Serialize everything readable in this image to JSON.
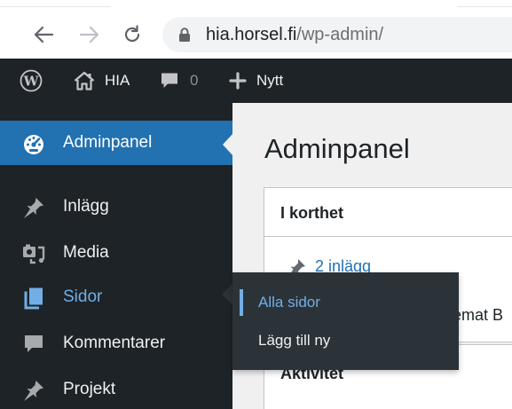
{
  "browser": {
    "url_host": "hia.horsel.fi",
    "url_path": "/wp-admin/"
  },
  "admin_bar": {
    "site_name": "HIA",
    "comments_count": "0",
    "new_label": "Nytt"
  },
  "sidebar": {
    "items": [
      {
        "label": "Adminpanel",
        "icon": "dashboard-icon",
        "state": "current"
      },
      {
        "label": "Inlägg",
        "icon": "pin-icon"
      },
      {
        "label": "Media",
        "icon": "media-icon"
      },
      {
        "label": "Sidor",
        "icon": "pages-icon",
        "state": "hovered"
      },
      {
        "label": "Kommentarer",
        "icon": "comment-icon"
      },
      {
        "label": "Projekt",
        "icon": "pin-icon"
      }
    ]
  },
  "flyout": {
    "items": [
      {
        "label": "Alla sidor",
        "state": "active"
      },
      {
        "label": "Lägg till ny"
      }
    ]
  },
  "main": {
    "title": "Adminpanel",
    "glance": {
      "title": "I korthet",
      "posts_link": "2 inlägg",
      "theme_text": "emat B"
    },
    "activity": {
      "title": "Aktivitet"
    }
  },
  "colors": {
    "admin_dark": "#1d2327",
    "accent_blue": "#2271b1",
    "hover_blue": "#72aee6",
    "flyout_bg": "#2c3338",
    "content_bg": "#f0f0f1"
  }
}
